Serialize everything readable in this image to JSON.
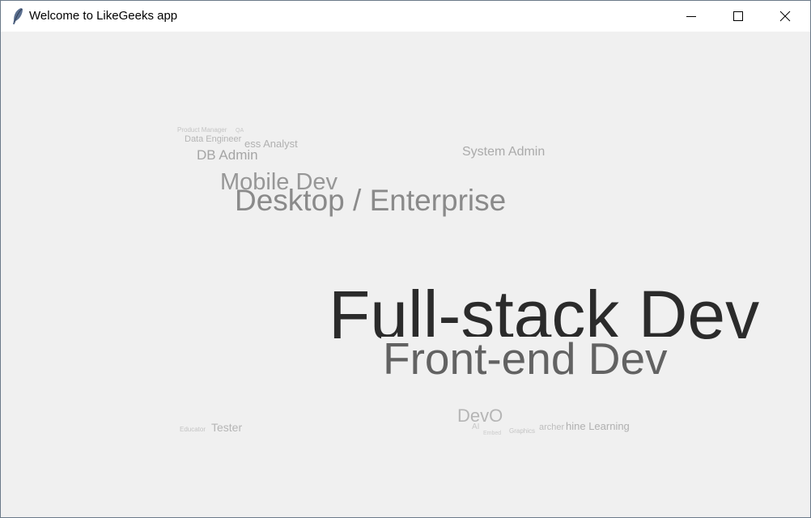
{
  "window": {
    "title": "Welcome to LikeGeeks app",
    "controls": {
      "minimize_icon": "minimize-icon",
      "maximize_icon": "maximize-icon",
      "close_icon": "close-icon"
    },
    "app_icon": "feather-icon"
  },
  "word_cloud": {
    "words": [
      {
        "id": "full-stack",
        "text": "Full-stack Dev",
        "color": "#2b2b2b"
      },
      {
        "id": "front-end",
        "text": "Front-end Dev",
        "color": "#626262"
      },
      {
        "id": "desktop",
        "text": "Desktop / Enterprise",
        "color": "#8a8a8a"
      },
      {
        "id": "mobile",
        "text": "Mobile Dev",
        "color": "#979797"
      },
      {
        "id": "db-admin",
        "text": "DB Admin",
        "color": "#a5a5a5"
      },
      {
        "id": "system-admin",
        "text": "System Admin",
        "color": "#aaaaaa"
      },
      {
        "id": "business-analyst",
        "text": "ess Analyst",
        "color": "#b0b0b0"
      },
      {
        "id": "data-engineer",
        "text": "Data Engineer",
        "color": "#b5b5b5"
      },
      {
        "id": "product-manager",
        "text": "Product Manager",
        "color": "#c4c4c4"
      },
      {
        "id": "qa",
        "text": "QA",
        "color": "#c8c8c8"
      },
      {
        "id": "tester",
        "text": "Tester",
        "color": "#b5b5b5"
      },
      {
        "id": "educator",
        "text": "Educator",
        "color": "#c4c4c4"
      },
      {
        "id": "devops",
        "text": "DevO",
        "color": "#b5b5b5"
      },
      {
        "id": "machine-learning",
        "text": "hine Learning",
        "color": "#b0b0b0"
      },
      {
        "id": "researcher",
        "text": "archer",
        "color": "#bdbdbd"
      },
      {
        "id": "graphics",
        "text": "Graphics",
        "color": "#c4c4c4"
      },
      {
        "id": "embedded",
        "text": "Embed",
        "color": "#cccccc"
      },
      {
        "id": "ai",
        "text": "AI",
        "color": "#c8c8c8"
      }
    ]
  }
}
